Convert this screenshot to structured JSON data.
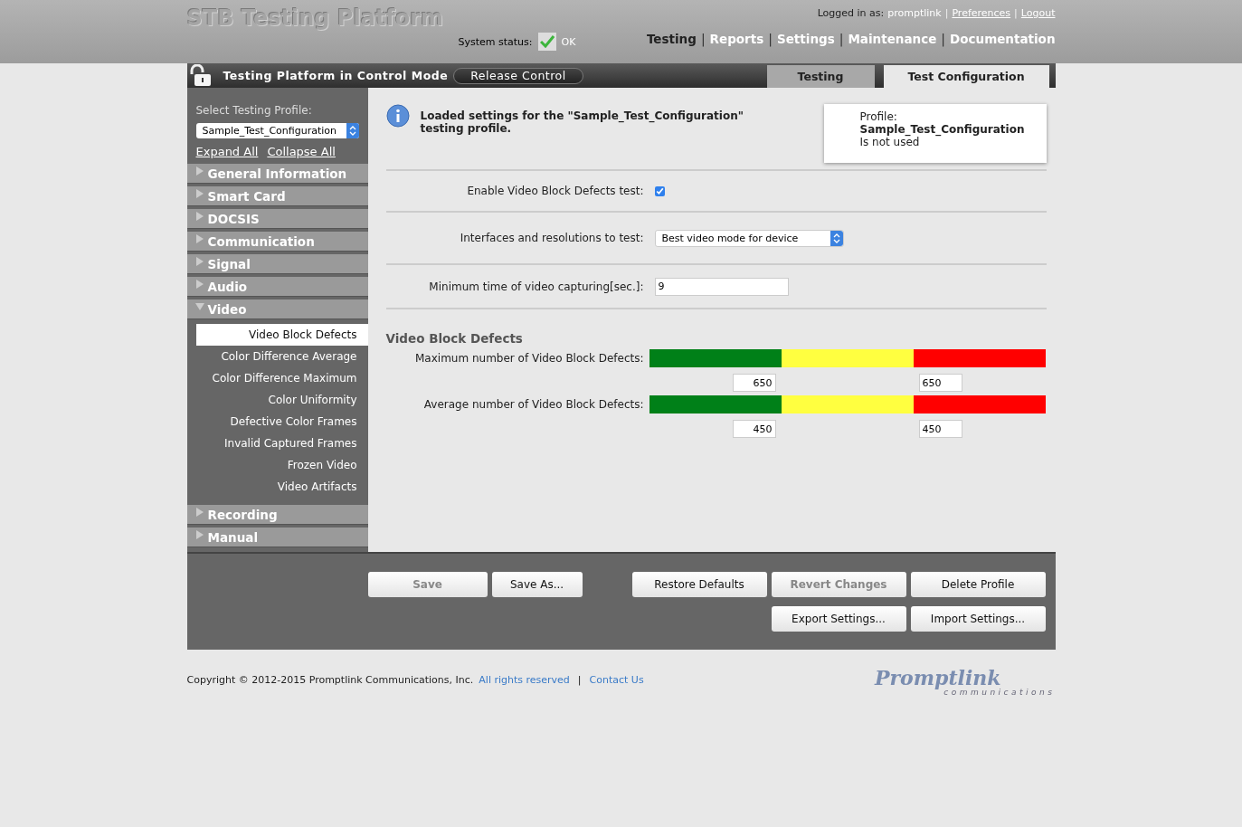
{
  "header": {
    "title": "STB Testing Platform",
    "logged_in_label": "Logged in as:",
    "user": "promptlink",
    "link_separators": [
      "|",
      "|"
    ],
    "links": [
      "Preferences",
      "Logout"
    ],
    "status_label": "System status:",
    "status_ok": true,
    "status_text": "OK",
    "nav_separators": [
      "|",
      "|",
      "|",
      "|"
    ],
    "nav": [
      {
        "label": "Testing",
        "selected": true
      },
      {
        "label": "Reports",
        "selected": false
      },
      {
        "label": "Settings",
        "selected": false
      },
      {
        "label": "Maintenance",
        "selected": false
      },
      {
        "label": "Documentation",
        "selected": false
      }
    ]
  },
  "control_bar": {
    "locked": false,
    "mode_text": "Testing Platform in Control Mode",
    "release_button": "Release Control",
    "tabs": [
      {
        "label": "Testing",
        "selected": false
      },
      {
        "label": "Test Configuration",
        "selected": true
      }
    ]
  },
  "sidebar": {
    "profile_label": "Select Testing Profile:",
    "profile_value": "Sample_Test_Configuration",
    "expand_all": "Expand All",
    "collapse_all": "Collapse All",
    "sections": [
      {
        "label": "General Information",
        "expanded": false
      },
      {
        "label": "Smart Card",
        "expanded": false
      },
      {
        "label": "DOCSIS",
        "expanded": false
      },
      {
        "label": "Communication",
        "expanded": false
      },
      {
        "label": "Signal",
        "expanded": false
      },
      {
        "label": "Audio",
        "expanded": false
      },
      {
        "label": "Video",
        "expanded": true,
        "children": [
          {
            "label": "Video Block Defects",
            "selected": true
          },
          {
            "label": "Color Difference Average",
            "selected": false
          },
          {
            "label": "Color Difference Maximum",
            "selected": false
          },
          {
            "label": "Color Uniformity",
            "selected": false
          },
          {
            "label": "Defective Color Frames",
            "selected": false
          },
          {
            "label": "Invalid Captured Frames",
            "selected": false
          },
          {
            "label": "Frozen Video",
            "selected": false
          },
          {
            "label": "Video Artifacts",
            "selected": false
          }
        ]
      },
      {
        "label": "Recording",
        "expanded": false
      },
      {
        "label": "Manual",
        "expanded": false
      }
    ]
  },
  "message": {
    "text": "Loaded settings for the \"Sample_Test_Configuration\" testing profile."
  },
  "profile_card": {
    "label": "Profile:",
    "name": "Sample_Test_Configuration",
    "status": "Is not used"
  },
  "fields": [
    {
      "kind": "checkbox",
      "label": "Enable Video Block Defects test:",
      "checked": true
    },
    {
      "kind": "select",
      "label": "Interfaces and resolutions to test:",
      "value": "Best video mode for device"
    },
    {
      "kind": "text",
      "label": "Minimum time of video capturing[sec.]:",
      "value": "9"
    }
  ],
  "thresholds": {
    "title": "Video Block Defects",
    "rows": [
      {
        "label": "Maximum number of Video Block Defects:",
        "low": "650",
        "high": "650"
      },
      {
        "label": "Average number of Video Block Defects:",
        "low": "450",
        "high": "450"
      }
    ]
  },
  "actions": {
    "left": [
      {
        "label": "Save",
        "disabled": true
      },
      {
        "label": "Save As...",
        "disabled": false
      }
    ],
    "right": [
      {
        "label": "Restore Defaults",
        "disabled": false
      },
      {
        "label": "Revert Changes",
        "disabled": true
      },
      {
        "label": "Delete Profile",
        "disabled": false
      }
    ],
    "second_row": [
      {
        "label": "Export Settings...",
        "disabled": false
      },
      {
        "label": "Import Settings...",
        "disabled": false
      }
    ]
  },
  "footer": {
    "copyright": "Copyright © 2012-2015 Promptlink Communications, Inc.",
    "links": [
      "All rights reserved",
      "Contact Us"
    ],
    "separator": "|",
    "logo_main": "Promptlink",
    "logo_sub": "communications"
  }
}
